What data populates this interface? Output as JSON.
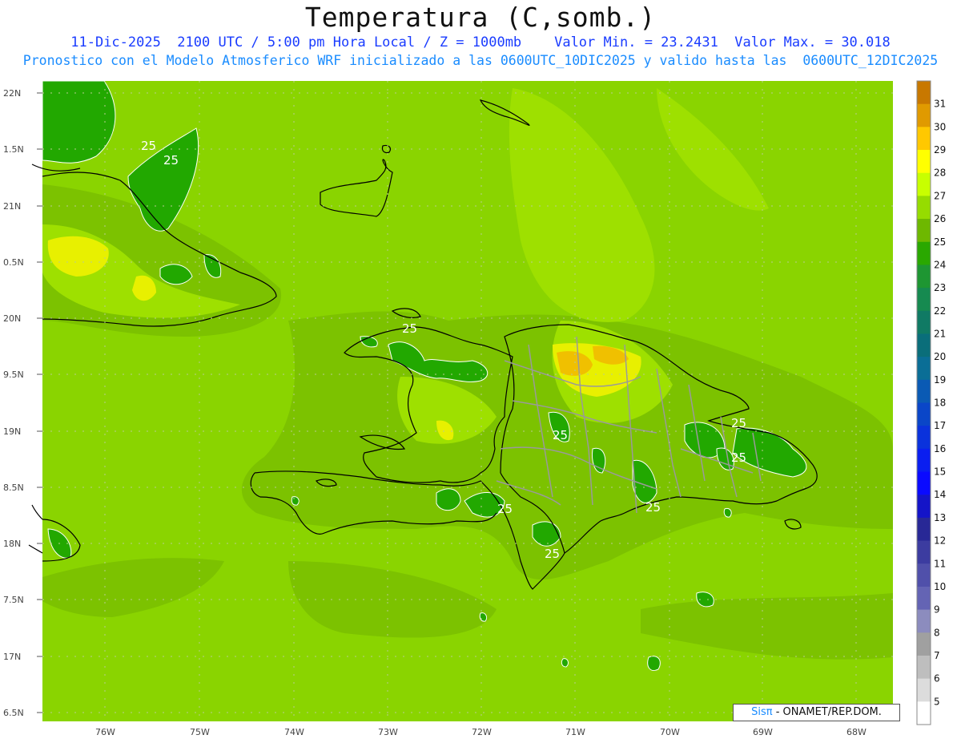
{
  "header": {
    "title": "Temperatura (C,somb.)",
    "line1": "11-Dic-2025  2100 UTC / 5:00 pm Hora Local / Z = 1000mb    Valor Min. = 23.2431  Valor Max. = 30.018",
    "line2": "Pronostico con el Modelo Atmosferico WRF inicializado a las 0600UTC_10DIC2025 y valido hasta las  0600UTC_12DIC2025"
  },
  "axes": {
    "lat_labels": [
      "22N",
      "1.5N",
      "21N",
      "0.5N",
      "20N",
      "9.5N",
      "19N",
      "8.5N",
      "18N",
      "7.5N",
      "17N",
      "6.5N"
    ],
    "lon_labels": [
      "76W",
      "75W",
      "74W",
      "73W",
      "72W",
      "71W",
      "70W",
      "69W",
      "68W"
    ]
  },
  "contour_labels": [
    "25",
    "25",
    "25",
    "25",
    "25",
    "25",
    "25",
    "25",
    "25"
  ],
  "colorbar": {
    "levels": [
      "31",
      "30",
      "29",
      "28",
      "27",
      "26",
      "25",
      "24",
      "23",
      "22",
      "21",
      "20",
      "19",
      "18",
      "17",
      "16",
      "15",
      "14",
      "13",
      "12",
      "11",
      "10",
      "9",
      "8",
      "7",
      "6",
      "5"
    ],
    "colors": [
      "#c87800",
      "#e09a00",
      "#ffc800",
      "#ffff00",
      "#c8ff00",
      "#96dc00",
      "#6eb800",
      "#2aa800",
      "#1e9632",
      "#168a50",
      "#107a64",
      "#0a6e7a",
      "#0a6e96",
      "#0a5ab4",
      "#0a46c8",
      "#0a32dc",
      "#0a1ef0",
      "#0a0aff",
      "#1414c8",
      "#282896",
      "#3c3ca0",
      "#5050aa",
      "#6464b4",
      "#8c8cbe",
      "#a0a0a0",
      "#bebebe",
      "#dcdcdc",
      "#ffffff"
    ]
  },
  "credit": {
    "brand": "Sisπ",
    "text": " - ONAMET/REP.DOM."
  }
}
